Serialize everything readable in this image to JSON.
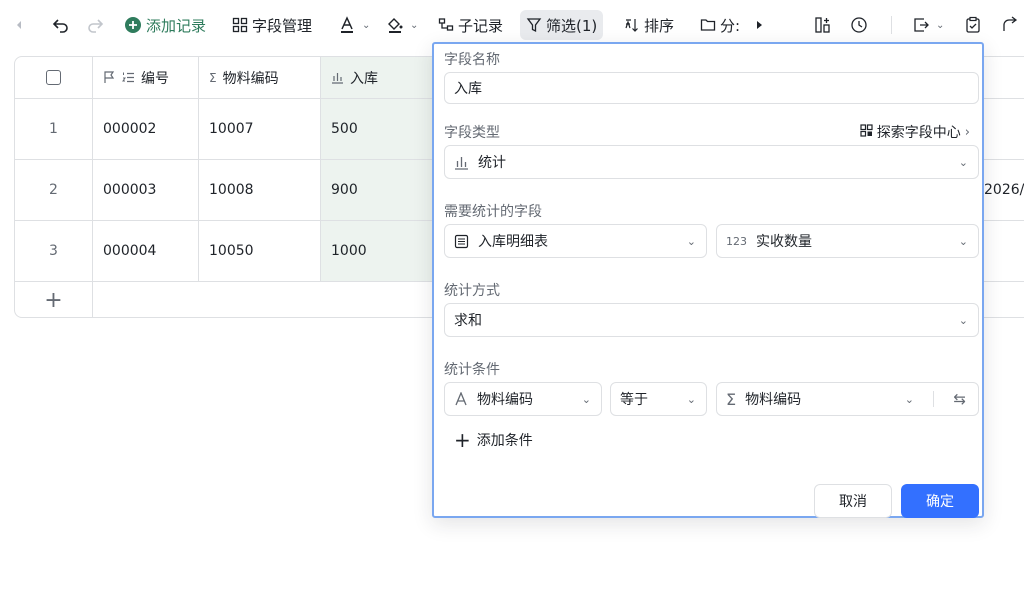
{
  "toolbar": {
    "add_record": "添加记录",
    "field_manage": "字段管理",
    "sub_record": "子记录",
    "filter": "筛选(1)",
    "sort": "排序",
    "group": "分:"
  },
  "table": {
    "headers": {
      "number": "编号",
      "material_code": "物料编码",
      "inbound": "入库"
    },
    "rows": [
      {
        "index": "1",
        "number": "000002",
        "material_code": "10007",
        "inbound": "500"
      },
      {
        "index": "2",
        "number": "000003",
        "material_code": "10008",
        "inbound": "900"
      },
      {
        "index": "3",
        "number": "000004",
        "material_code": "10050",
        "inbound": "1000"
      }
    ],
    "add_row": "+",
    "right_date_partial": "2026/("
  },
  "panel": {
    "field_name_label": "字段名称",
    "field_name_value": "入库",
    "field_type_label": "字段类型",
    "explore_link": "探索字段中心",
    "field_type_value": "统计",
    "stat_field_label": "需要统计的字段",
    "stat_table_value": "入库明细表",
    "stat_field_value": "实收数量",
    "stat_field_prefix": "123",
    "stat_method_label": "统计方式",
    "stat_method_value": "求和",
    "stat_condition_label": "统计条件",
    "cond_field": "物料编码",
    "cond_op": "等于",
    "cond_value": "物料编码",
    "add_condition": "添加条件",
    "cancel": "取消",
    "confirm": "确定"
  },
  "colors": {
    "accent": "#3370ff",
    "green": "#2f7c5d",
    "highlight": "#edf3ef",
    "panel_border": "#7aa7f0"
  }
}
